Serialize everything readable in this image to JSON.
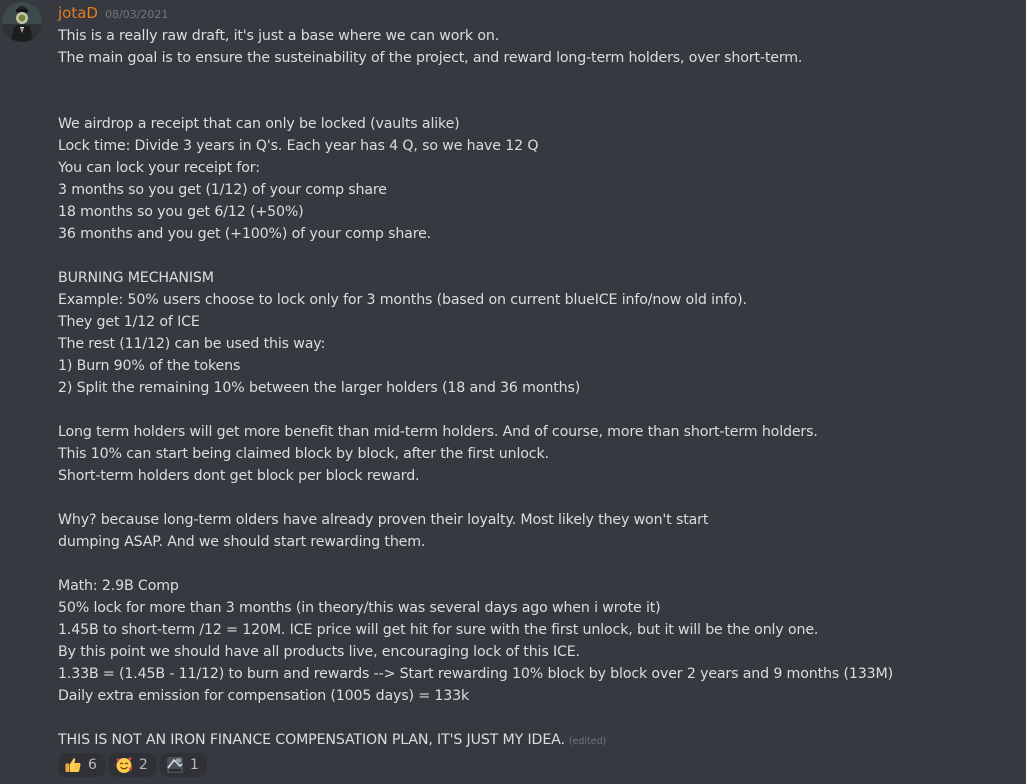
{
  "author": {
    "name": "jotaD",
    "timestamp": "08/03/2021"
  },
  "message": {
    "lines": [
      "This is a really raw draft, it's just a base where we can work on.",
      "The main goal is to ensure the susteinability of the project, and reward long-term holders, over short-term.",
      "",
      "",
      "We airdrop a receipt that can only be locked (vaults alike)",
      "Lock time: Divide 3 years in Q's. Each year has 4 Q, so we have 12 Q",
      "You can lock your receipt for:",
      "3 months so you get (1/12) of your comp share",
      "18 months so you get 6/12 (+50%)",
      "36 months and you get (+100%) of your comp share.",
      "",
      "BURNING MECHANISM",
      "Example: 50% users choose to lock only for 3 months (based on current blueICE info/now old info).",
      "They get 1/12 of ICE",
      "The rest (11/12) can be used this way:",
      "1) Burn 90% of the tokens",
      "2) Split the remaining 10% between the larger holders (18 and 36 months)",
      "",
      "Long term holders will get more benefit than mid-term holders. And of course, more than short-term holders.",
      "This 10% can start being claimed block by block, after the first unlock.",
      "Short-term holders dont get block per block reward.",
      "",
      "Why? because long-term olders have already proven their loyalty. Most likely they won't start",
      "dumping ASAP. And we should start rewarding them.",
      "",
      "Math: 2.9B Comp",
      "50% lock for more than 3 months (in theory/this was several days ago when i wrote it)",
      "1.45B to short-term /12 = 120M. ICE price will get hit for sure with the first unlock, but it will be the only one.",
      "By this point we should have all products live, encouraging lock of this ICE.",
      "1.33B = (1.45B - 11/12) to burn and rewards --> Start rewarding 10% block by block over 2 years and 9 months (133M)",
      "Daily extra emission for compensation (1005 days) = 133k",
      ""
    ],
    "final_line": "THIS IS NOT AN IRON FINANCE COMPENSATION PLAN, IT'S JUST MY IDEA.",
    "edited_label": "(edited)"
  },
  "reactions": [
    {
      "icon": "thumbs-up-icon",
      "count": "6"
    },
    {
      "icon": "smiling-face-with-hearts-icon",
      "count": "2"
    },
    {
      "icon": "custom-emoji-icon",
      "count": "1"
    }
  ],
  "colors": {
    "background": "#36393f",
    "text": "#dcddde",
    "username": "#e67e22",
    "muted": "#72767d",
    "reaction_bg": "#2f3136"
  }
}
